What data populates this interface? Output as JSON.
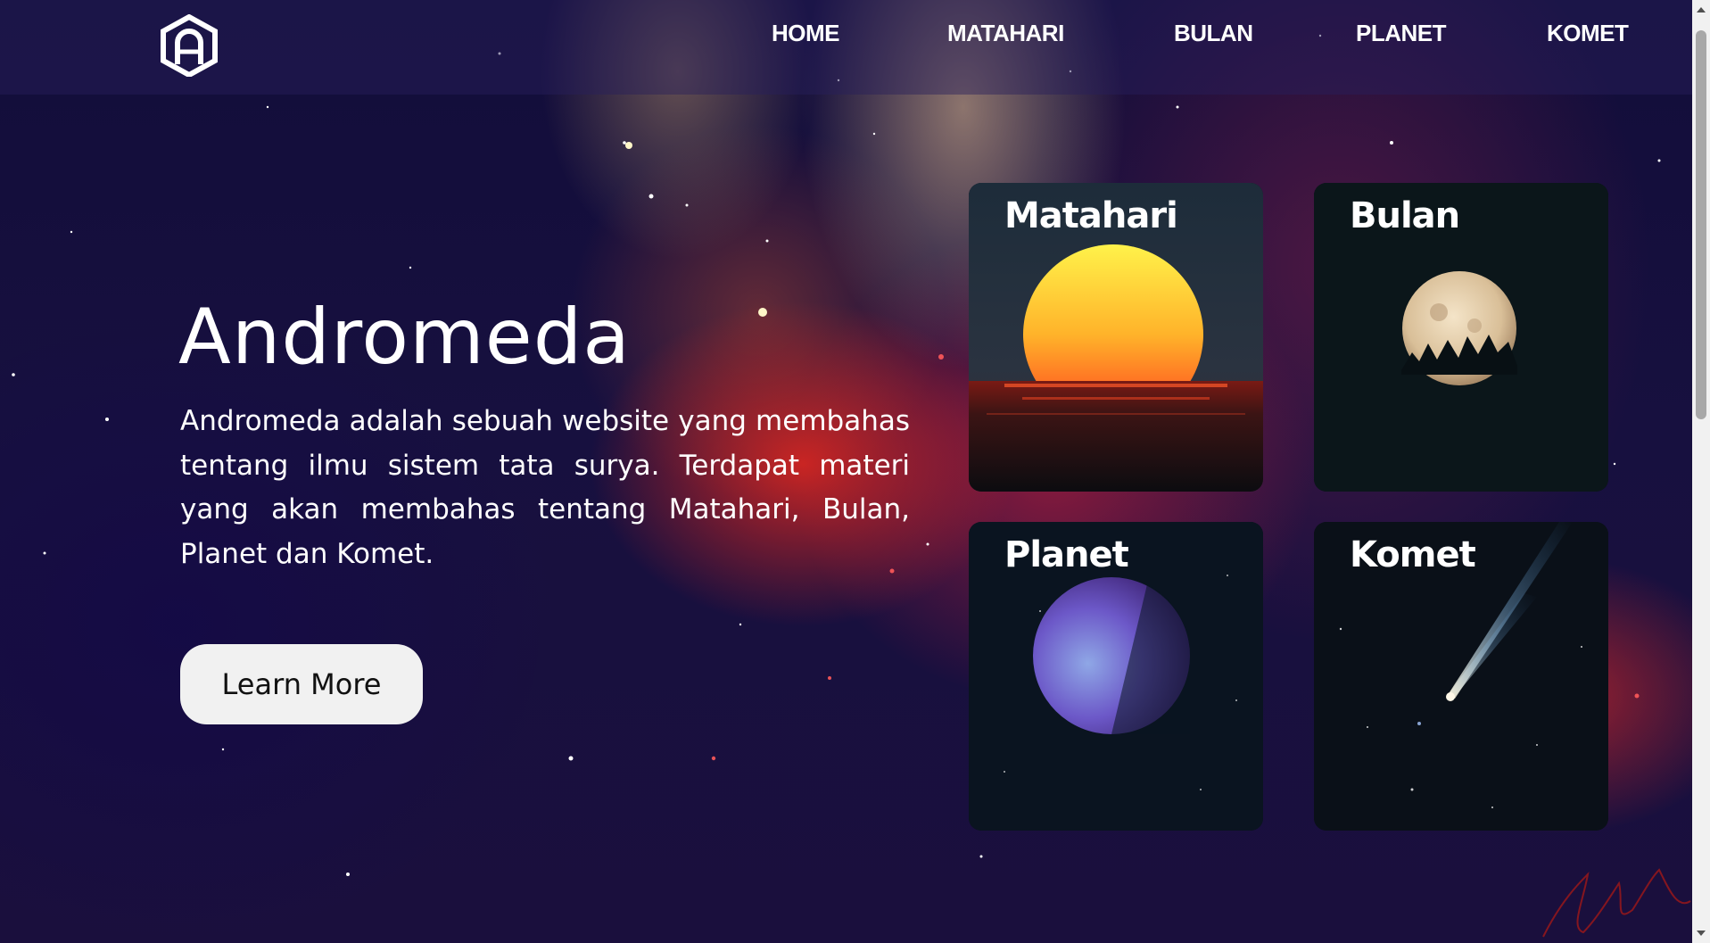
{
  "nav": {
    "links": [
      "HOME",
      "MATAHARI",
      "BULAN",
      "PLANET",
      "KOMET"
    ],
    "logo_icon": "hexagon-a-logo-icon"
  },
  "hero": {
    "title": "Andromeda",
    "description": "Andromeda adalah sebuah website yang membahas tentang ilmu sistem tata surya. Terdapat materi yang akan membahas tentang Matahari, Bulan, Planet dan Komet.",
    "button_label": "Learn More"
  },
  "cards": [
    {
      "title": "Matahari",
      "image": "sunset-over-sea"
    },
    {
      "title": "Bulan",
      "image": "full-moon-over-trees"
    },
    {
      "title": "Planet",
      "image": "purple-planet"
    },
    {
      "title": "Komet",
      "image": "comet-in-starfield"
    }
  ],
  "colors": {
    "button_bg": "#f1f1f1",
    "nav_bg": "rgba(40,30,90,0.45)",
    "space_base": "#120d3a",
    "nebula_red": "#e6281e"
  }
}
